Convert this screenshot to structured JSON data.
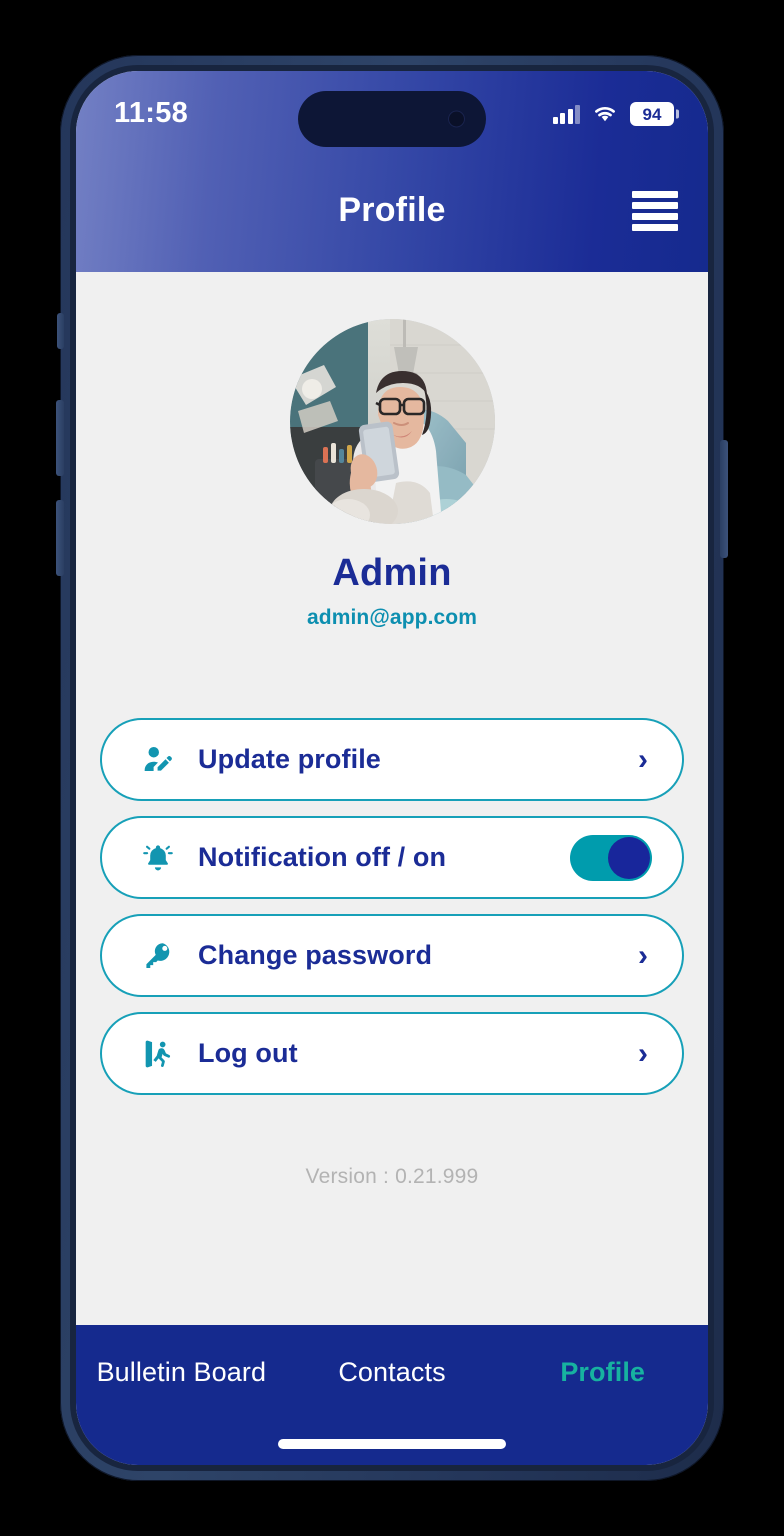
{
  "status_bar": {
    "time": "11:58",
    "signal_icon": "cellular-signal-icon",
    "wifi_icon": "wifi-icon",
    "battery_level": "94"
  },
  "header": {
    "title": "Profile",
    "menu_icon": "hamburger-menu-icon",
    "gradient_from": "#7380c4",
    "gradient_to": "#152a8e"
  },
  "profile": {
    "avatar_icon": "user-avatar-photo",
    "name": "Admin",
    "email": "admin@app.com",
    "name_color": "#1b2c96",
    "email_color": "#0d8fb0"
  },
  "menu": {
    "items": [
      {
        "label": "Update profile",
        "icon": "user-edit-icon",
        "control": "chevron",
        "chevron": "›"
      },
      {
        "label": "Notification off / on",
        "icon": "bell-icon",
        "control": "toggle",
        "toggle_state": "on"
      },
      {
        "label": "Change password",
        "icon": "key-icon",
        "control": "chevron",
        "chevron": "›"
      },
      {
        "label": "Log out",
        "icon": "logout-icon",
        "control": "chevron",
        "chevron": "›"
      }
    ],
    "accent_border": "#17a0b8",
    "icon_color": "#1295b0",
    "label_color": "#1b2c96",
    "toggle_track_color": "#009cad",
    "toggle_knob_color": "#18269b"
  },
  "footer": {
    "version": "Version : 0.21.999"
  },
  "bottom_nav": {
    "background": "#152a8e",
    "active_color": "#17b2a0",
    "items": [
      {
        "label": "Bulletin Board",
        "active": false
      },
      {
        "label": "Contacts",
        "active": false
      },
      {
        "label": "Profile",
        "active": true
      }
    ]
  }
}
